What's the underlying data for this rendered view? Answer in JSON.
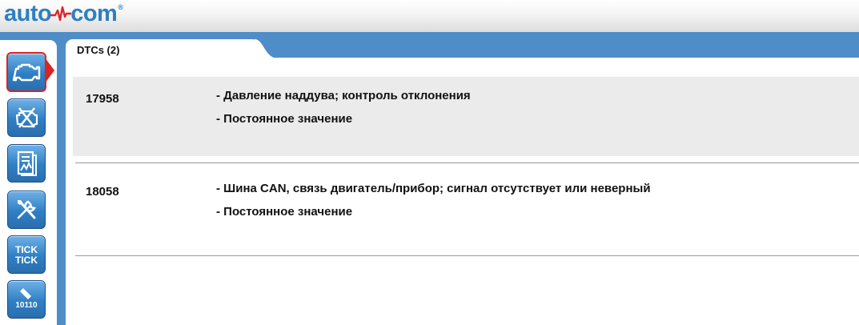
{
  "app": {
    "logo_left": "auto",
    "logo_right": "com",
    "logo_reg": "®"
  },
  "tab": {
    "label": "DTCs (2)"
  },
  "sidebar": {
    "buttons": [
      {
        "icon": "engine-icon",
        "active": true
      },
      {
        "icon": "engine-clear-icon",
        "active": false
      },
      {
        "icon": "data-sheet-icon",
        "active": false
      },
      {
        "icon": "tools-icon",
        "active": false
      },
      {
        "icon": "tick-tick-icon",
        "text": "TICK\nTICK",
        "active": false
      },
      {
        "icon": "binary-pen-icon",
        "text": "10110",
        "active": false
      }
    ],
    "tick_line1": "TICK",
    "tick_line2": "TICK",
    "binary": "10110"
  },
  "dtcs": [
    {
      "code": "17958",
      "line1": "- Давление наддува; контроль отклонения",
      "line2": "- Постоянное значение"
    },
    {
      "code": "18058",
      "line1": "- Шина CAN, связь двигатель/прибор; сигнал отсутствует или неверный",
      "line2": "- Постоянное значение"
    }
  ],
  "colors": {
    "brand": "#2d7fc1",
    "bar": "#4e8dc7",
    "active_border": "#dd2222",
    "row_highlight": "#ebebeb"
  }
}
